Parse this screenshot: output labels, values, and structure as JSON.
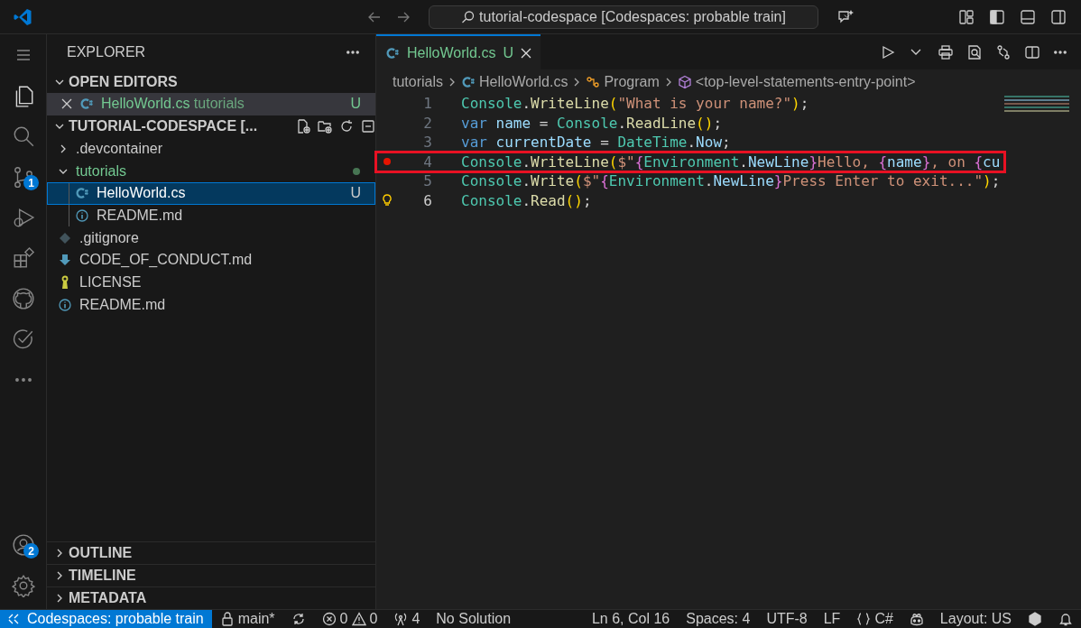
{
  "title_bar": {
    "search": "tutorial-codespace [Codespaces: probable train]"
  },
  "activity_bar": {
    "top": [
      {
        "kind": "explorer",
        "selected": true
      },
      {
        "kind": "search",
        "selected": false
      },
      {
        "kind": "source-control",
        "selected": false,
        "badge": "1"
      },
      {
        "kind": "debug",
        "selected": false
      },
      {
        "kind": "extensions",
        "selected": false
      },
      {
        "kind": "github",
        "selected": false
      },
      {
        "kind": "testing",
        "selected": false
      },
      {
        "kind": "more",
        "selected": false
      }
    ],
    "bottom": [
      {
        "kind": "accounts",
        "selected": false,
        "badge": "2"
      },
      {
        "kind": "settings",
        "selected": false
      }
    ]
  },
  "sidebar": {
    "title": "EXPLORER",
    "open_editors": {
      "title": "OPEN EDITORS",
      "expanded": true,
      "items": [
        {
          "name": "HelloWorld.cs",
          "folder": "tutorials",
          "status": "U",
          "kind": "csharp",
          "selected": true
        }
      ]
    },
    "workspace": {
      "title": "TUTORIAL-CODESPACE [...",
      "expanded": true,
      "tree": [
        {
          "name": ".devcontainer",
          "kind": "folder",
          "expanded": false,
          "changed": false,
          "selected": false
        },
        {
          "name": "tutorials",
          "kind": "folder",
          "expanded": true,
          "changed": true,
          "selected": false,
          "children": [
            {
              "name": "HelloWorld.cs",
              "kind": "csharp",
              "status": "U",
              "selected": true
            },
            {
              "name": "README.md",
              "kind": "info",
              "selected": false
            }
          ]
        },
        {
          "name": ".gitignore",
          "kind": "git",
          "selected": false
        },
        {
          "name": "CODE_OF_CONDUCT.md",
          "kind": "download",
          "selected": false
        },
        {
          "name": "LICENSE",
          "kind": "license",
          "selected": false
        },
        {
          "name": "README.md",
          "kind": "info",
          "selected": false
        }
      ]
    },
    "collapsed_sections": [
      {
        "title": "OUTLINE",
        "expanded": false
      },
      {
        "title": "TIMELINE",
        "expanded": false
      },
      {
        "title": "METADATA",
        "expanded": false
      }
    ]
  },
  "editor": {
    "tabs": [
      {
        "label": "HelloWorld.cs",
        "status": "U",
        "selected": true
      }
    ],
    "breadcrumbs": [
      {
        "kind": "folder",
        "text": "tutorials"
      },
      {
        "kind": "csharp",
        "text": "HelloWorld.cs"
      },
      {
        "kind": "class",
        "text": "Program"
      },
      {
        "kind": "method",
        "text": "<top-level-statements-entry-point>"
      }
    ],
    "lines": [
      {
        "number": "1",
        "breakpoint": false,
        "lightbulb": false,
        "highlighted": false,
        "tokens": [
          {
            "kind": "cls",
            "text": "Console"
          },
          {
            "kind": "p",
            "text": "."
          },
          {
            "kind": "fn",
            "text": "WriteLine"
          },
          {
            "kind": "par",
            "text": "("
          },
          {
            "kind": "str",
            "text": "\"What is your name?\""
          },
          {
            "kind": "par",
            "text": ")"
          },
          {
            "kind": "p",
            "text": ";"
          }
        ]
      },
      {
        "number": "2",
        "breakpoint": false,
        "lightbulb": false,
        "highlighted": false,
        "tokens": [
          {
            "kind": "kw",
            "text": "var "
          },
          {
            "kind": "var",
            "text": "name"
          },
          {
            "kind": "p",
            "text": " = "
          },
          {
            "kind": "cls",
            "text": "Console"
          },
          {
            "kind": "p",
            "text": "."
          },
          {
            "kind": "fn",
            "text": "ReadLine"
          },
          {
            "kind": "par",
            "text": "()"
          },
          {
            "kind": "p",
            "text": ";"
          }
        ]
      },
      {
        "number": "3",
        "breakpoint": false,
        "lightbulb": false,
        "highlighted": false,
        "tokens": [
          {
            "kind": "kw",
            "text": "var "
          },
          {
            "kind": "var",
            "text": "currentDate"
          },
          {
            "kind": "p",
            "text": " = "
          },
          {
            "kind": "cls",
            "text": "DateTime"
          },
          {
            "kind": "p",
            "text": "."
          },
          {
            "kind": "var",
            "text": "Now"
          },
          {
            "kind": "p",
            "text": ";"
          }
        ]
      },
      {
        "number": "4",
        "breakpoint": true,
        "lightbulb": false,
        "highlighted": true,
        "tokens": [
          {
            "kind": "cls",
            "text": "Console"
          },
          {
            "kind": "p",
            "text": "."
          },
          {
            "kind": "fn",
            "text": "WriteLine"
          },
          {
            "kind": "par",
            "text": "("
          },
          {
            "kind": "str",
            "text": "$\""
          },
          {
            "kind": "brace",
            "text": "{"
          },
          {
            "kind": "cls",
            "text": "Environment"
          },
          {
            "kind": "p",
            "text": "."
          },
          {
            "kind": "var",
            "text": "NewLine"
          },
          {
            "kind": "brace",
            "text": "}"
          },
          {
            "kind": "str",
            "text": "Hello, "
          },
          {
            "kind": "brace",
            "text": "{"
          },
          {
            "kind": "var",
            "text": "name"
          },
          {
            "kind": "brace",
            "text": "}"
          },
          {
            "kind": "str",
            "text": ", on "
          },
          {
            "kind": "brace",
            "text": "{"
          },
          {
            "kind": "var",
            "text": "cu"
          }
        ]
      },
      {
        "number": "5",
        "breakpoint": false,
        "lightbulb": false,
        "highlighted": false,
        "tokens": [
          {
            "kind": "cls",
            "text": "Console"
          },
          {
            "kind": "p",
            "text": "."
          },
          {
            "kind": "fn",
            "text": "Write"
          },
          {
            "kind": "par",
            "text": "("
          },
          {
            "kind": "str",
            "text": "$\""
          },
          {
            "kind": "brace",
            "text": "{"
          },
          {
            "kind": "cls",
            "text": "Environment"
          },
          {
            "kind": "p",
            "text": "."
          },
          {
            "kind": "var",
            "text": "NewLine"
          },
          {
            "kind": "brace",
            "text": "}"
          },
          {
            "kind": "str",
            "text": "Press Enter to exit...\""
          },
          {
            "kind": "par",
            "text": ")"
          },
          {
            "kind": "p",
            "text": ";"
          }
        ]
      },
      {
        "number": "6",
        "breakpoint": false,
        "lightbulb": true,
        "highlighted": false,
        "tokens": [
          {
            "kind": "cls",
            "text": "Console"
          },
          {
            "kind": "p",
            "text": "."
          },
          {
            "kind": "fn",
            "text": "Read"
          },
          {
            "kind": "par",
            "text": "()"
          },
          {
            "kind": "p",
            "text": ";"
          }
        ]
      }
    ]
  },
  "status_bar": {
    "remote": "Codespaces: probable train",
    "left": [
      {
        "kind": "branch",
        "text": "main*"
      },
      {
        "kind": "sync"
      },
      {
        "kind": "errors",
        "text": "0"
      },
      {
        "kind": "warnings",
        "text": "0"
      },
      {
        "kind": "ports",
        "text": "4"
      },
      {
        "kind": "plain",
        "text": "No Solution"
      }
    ],
    "right": [
      {
        "kind": "plain",
        "text": "Ln 6, Col 16"
      },
      {
        "kind": "plain",
        "text": "Spaces: 4"
      },
      {
        "kind": "plain",
        "text": "UTF-8"
      },
      {
        "kind": "plain",
        "text": "LF"
      },
      {
        "kind": "language",
        "text": "C#"
      },
      {
        "kind": "copilot"
      },
      {
        "kind": "plain",
        "text": "Layout: US"
      },
      {
        "kind": "csharp-ext"
      },
      {
        "kind": "bell"
      }
    ]
  }
}
